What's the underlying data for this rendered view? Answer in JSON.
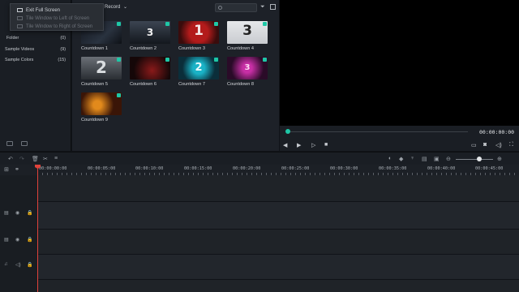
{
  "context_menu": {
    "items": [
      {
        "label": "Exit Full Screen",
        "enabled": true
      },
      {
        "label": "Tile Window to Left of Screen",
        "enabled": false
      },
      {
        "label": "Tile Window to Right of Screen",
        "enabled": false
      }
    ]
  },
  "sidebar": {
    "items": [
      {
        "label": "Folder",
        "count": "(0)"
      },
      {
        "label": "Sample Videos",
        "count": "(9)"
      },
      {
        "label": "Sample Colors",
        "count": "(15)"
      }
    ]
  },
  "media": {
    "toolbar_label": "Record",
    "search_placeholder": "Search",
    "items": [
      {
        "name": "Countdown 1",
        "glyph": ""
      },
      {
        "name": "Countdown 2",
        "glyph": "3"
      },
      {
        "name": "Countdown 3",
        "glyph": "1"
      },
      {
        "name": "Countdown 4",
        "glyph": "3"
      },
      {
        "name": "Countdown 5",
        "glyph": "2"
      },
      {
        "name": "Countdown 6",
        "glyph": ""
      },
      {
        "name": "Countdown 7",
        "glyph": "2"
      },
      {
        "name": "Countdown 8",
        "glyph": "3"
      },
      {
        "name": "Countdown 9",
        "glyph": ""
      }
    ]
  },
  "preview": {
    "timecode": "00:00:00:00",
    "progress": 0
  },
  "timeline": {
    "ruler_labels": [
      "00:00:00:00",
      "00:00:05:00",
      "00:00:10:00",
      "00:00:15:00",
      "00:00:20:00",
      "00:00:25:00",
      "00:00:30:00",
      "00:00:35:00",
      "00:00:40:00",
      "00:00:45:00"
    ],
    "zoom_level": 0.6
  },
  "colors": {
    "accent": "#1ec7a6",
    "playhead": "#e0423b"
  }
}
